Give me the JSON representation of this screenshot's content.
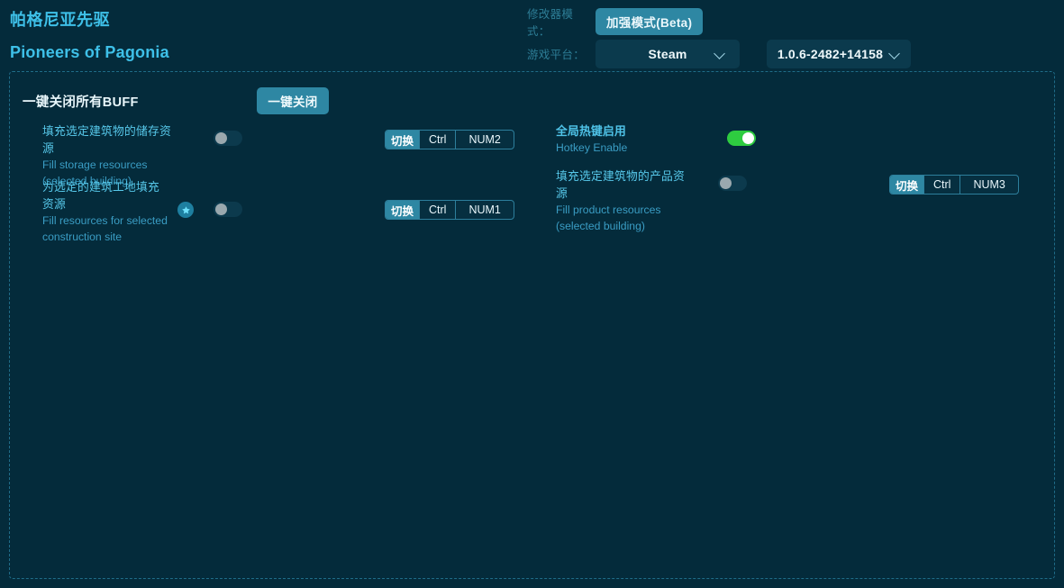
{
  "header": {
    "title_cn": "帕格尼亚先驱",
    "title_en": "Pioneers of Pagonia",
    "mode_label": "修改器模式：",
    "mode_value": "加强模式(Beta)",
    "platform_label": "游戏平台：",
    "platform_value": "Steam",
    "version_value": "1.0.6-2482+14158",
    "chevron_icon": "chevron-down-icon"
  },
  "panel": {
    "onekey_label": "一键关闭所有BUFF",
    "onekey_button": "一键关闭",
    "left_features": [
      {
        "cn": "填充选定建筑物的储存资源",
        "en": "Fill storage resources\n(selected building)",
        "en_line1": "Fill storage resources",
        "en_line2": "(selected building)",
        "toggle_state": "off",
        "has_star": false,
        "hotkey": {
          "action": "切换",
          "modifier": "Ctrl",
          "key": "NUM2"
        }
      },
      {
        "cn_line1": "为选定的建筑工地填充",
        "cn_line2": "资源",
        "en_line1": "Fill resources for selected",
        "en_line2": "construction site",
        "toggle_state": "off",
        "has_star": true,
        "star_icon": "star-icon",
        "hotkey": {
          "action": "切换",
          "modifier": "Ctrl",
          "key": "NUM1"
        }
      }
    ],
    "right_features": [
      {
        "cn": "全局热键启用",
        "en_line1": "Hotkey Enable",
        "en_line2": "",
        "toggle_state": "on",
        "has_star": false,
        "hotkey": null
      },
      {
        "cn": "填充选定建筑物的产品资源",
        "en_line1": "Fill product resources",
        "en_line2": "(selected building)",
        "toggle_state": "off",
        "has_star": false,
        "hotkey": {
          "action": "切换",
          "modifier": "Ctrl",
          "key": "NUM3"
        }
      }
    ]
  },
  "colors": {
    "background": "#042b3b",
    "accent": "#2e87a3",
    "text_cn": "#57c8ea",
    "text_en": "#3a9dc4",
    "toggle_on": "#2ecc40",
    "border_dashed": "#1f6c88"
  }
}
